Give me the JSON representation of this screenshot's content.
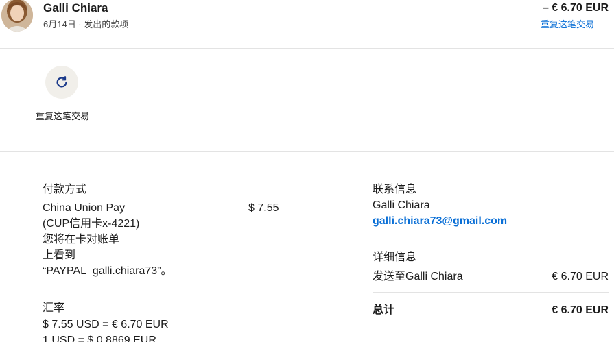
{
  "header": {
    "name": "Galli Chiara",
    "subline": "6月14日 · 发出的款项",
    "amount": "– € 6.70 EUR",
    "repeat_link": "重复这笔交易"
  },
  "actions": {
    "repeat_label": "重复这笔交易"
  },
  "payment": {
    "title": "付款方式",
    "lines": [
      "China Union Pay",
      "(CUP信用卡x-4221)",
      "您将在卡对账单",
      "上看到",
      "“PAYPAL_galli.chiara73”。"
    ],
    "amount": "$ 7.55"
  },
  "exchange": {
    "title": "汇率",
    "line1": "$ 7.55 USD = € 6.70 EUR",
    "line2": "1 USD = $ 0.8869 EUR"
  },
  "contact": {
    "title": "联系信息",
    "name": "Galli Chiara",
    "email": "galli.chiara73@gmail.com"
  },
  "details": {
    "title": "详细信息",
    "sent_to_label": "发送至Galli Chiara",
    "sent_to_amount": "€ 6.70 EUR",
    "total_label": "总计",
    "total_amount": "€ 6.70 EUR"
  }
}
